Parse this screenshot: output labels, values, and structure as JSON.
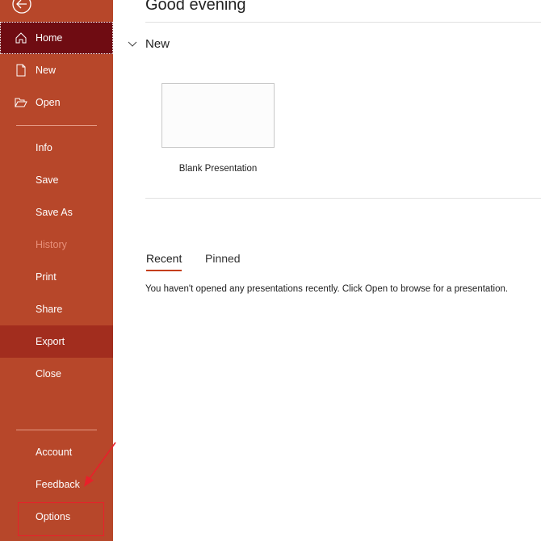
{
  "sidebar": {
    "items": [
      {
        "label": "Home"
      },
      {
        "label": "New"
      },
      {
        "label": "Open"
      },
      {
        "label": "Info"
      },
      {
        "label": "Save"
      },
      {
        "label": "Save As"
      },
      {
        "label": "History"
      },
      {
        "label": "Print"
      },
      {
        "label": "Share"
      },
      {
        "label": "Export"
      },
      {
        "label": "Close"
      },
      {
        "label": "Account"
      },
      {
        "label": "Feedback"
      },
      {
        "label": "Options"
      }
    ]
  },
  "main": {
    "greeting": "Good evening",
    "new_section": "New",
    "blank_label": "Blank Presentation",
    "tabs": [
      {
        "label": "Recent"
      },
      {
        "label": "Pinned"
      }
    ],
    "empty_message": "You haven't opened any presentations recently. Click Open to browse for a presentation."
  },
  "colors": {
    "sidebar": "#b7472a",
    "selected": "#6f0c12",
    "accent": "#c43e1c"
  }
}
